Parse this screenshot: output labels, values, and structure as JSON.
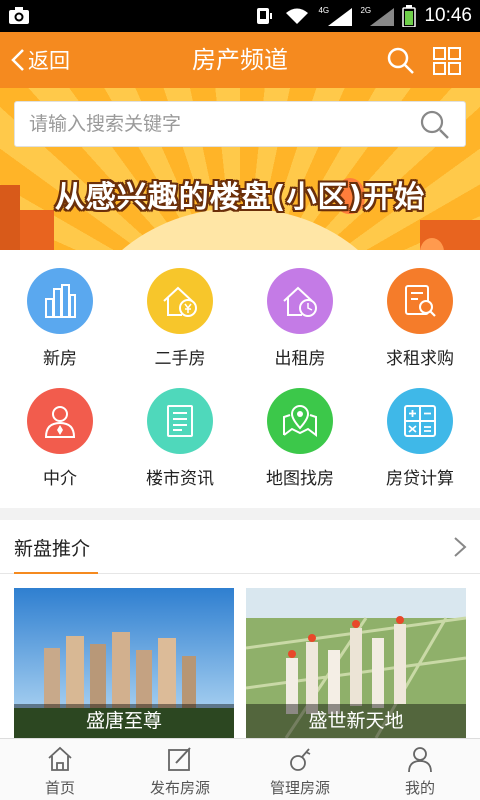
{
  "status_bar": {
    "network_4g": "4G",
    "network_2g": "2G",
    "time": "10:46"
  },
  "header": {
    "back_label": "返回",
    "title": "房产频道"
  },
  "banner": {
    "search_placeholder": "请输入搜索关键字",
    "slogan": "从感兴趣的楼盘(小区)开始"
  },
  "categories": [
    {
      "label": "新房",
      "icon": "buildings-icon",
      "color": "#5aa8ef"
    },
    {
      "label": "二手房",
      "icon": "house-yen-icon",
      "color": "#f7c62b"
    },
    {
      "label": "出租房",
      "icon": "house-clock-icon",
      "color": "#c47be6"
    },
    {
      "label": "求租求购",
      "icon": "document-search-icon",
      "color": "#f57c2a"
    },
    {
      "label": "中介",
      "icon": "agent-person-icon",
      "color": "#f25c4d"
    },
    {
      "label": "楼市资讯",
      "icon": "news-document-icon",
      "color": "#4fd8bb"
    },
    {
      "label": "地图找房",
      "icon": "map-pin-icon",
      "color": "#3cc84a"
    },
    {
      "label": "房贷计算",
      "icon": "calculator-icon",
      "color": "#3fb8e8"
    }
  ],
  "new_listings": {
    "title": "新盘推介",
    "cards": [
      {
        "name": "盛唐至尊"
      },
      {
        "name": "盛世新天地"
      }
    ]
  },
  "tabbar": [
    {
      "label": "首页",
      "icon": "home-icon"
    },
    {
      "label": "发布房源",
      "icon": "edit-icon"
    },
    {
      "label": "管理房源",
      "icon": "key-icon"
    },
    {
      "label": "我的",
      "icon": "person-icon"
    }
  ],
  "colors": {
    "accent": "#f58a1f",
    "status_bar": "#000000"
  }
}
